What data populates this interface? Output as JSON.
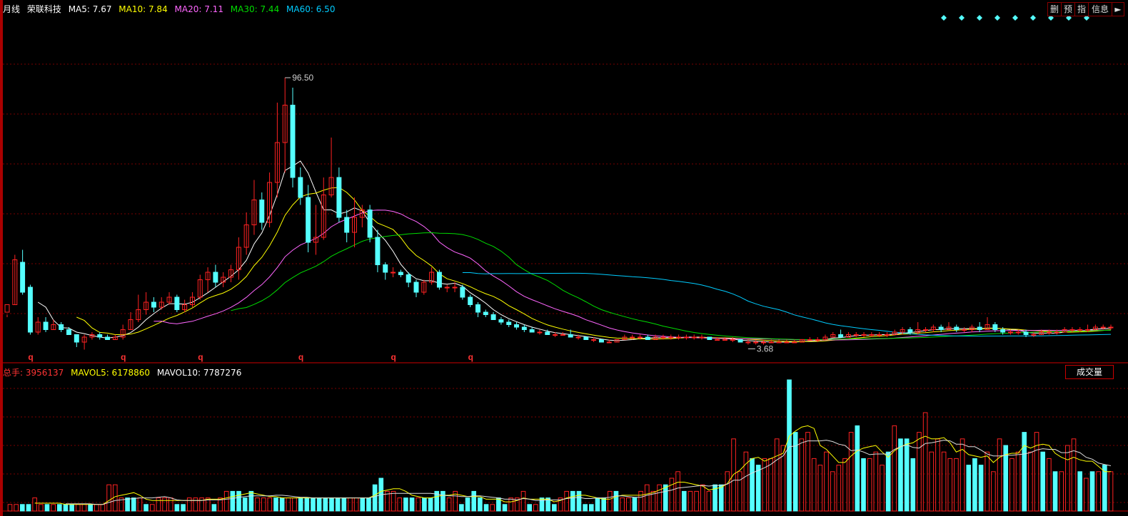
{
  "header": {
    "period": "月线",
    "stock_name": "荣联科技",
    "ma": [
      {
        "label": "MA5: 7.67",
        "color": "#ffffff"
      },
      {
        "label": "MA10: 7.84",
        "color": "#ffff00"
      },
      {
        "label": "MA20: 7.11",
        "color": "#ff66ff"
      },
      {
        "label": "MA30: 7.44",
        "color": "#00dd00"
      },
      {
        "label": "MA60: 6.50",
        "color": "#00ccff"
      }
    ]
  },
  "toolbar": {
    "del": "删",
    "pre": "预",
    "ind": "指",
    "info": "信息",
    "arrow": "►"
  },
  "volume_header": {
    "total": "总手: 3956137",
    "mavol5": "MAVOL5: 6178860",
    "mavol10": "MAVOL10: 7787276",
    "button": "成交量"
  },
  "colors": {
    "up": "#ff2222",
    "down": "#55ffff",
    "grid": "#7a0000",
    "bg": "#000000"
  },
  "chart_data": {
    "type": "candlestick",
    "annotations": {
      "high": "96.50",
      "low": "3.68",
      "q_marker": "q"
    },
    "q_marker_indices": [
      3,
      15,
      25,
      38,
      50,
      60
    ],
    "info_marker_count": 9,
    "candles": [
      [
        12,
        15,
        11,
        10
      ],
      [
        15,
        33,
        35,
        15
      ],
      [
        32,
        20,
        37,
        19
      ],
      [
        22,
        4,
        23,
        3
      ],
      [
        4,
        8,
        10,
        3
      ],
      [
        8,
        5,
        10,
        4
      ],
      [
        5,
        7,
        9,
        5
      ],
      [
        7,
        5,
        8,
        4
      ],
      [
        5,
        3,
        6,
        3
      ],
      [
        3,
        0,
        3,
        -2
      ],
      [
        0,
        2,
        3,
        -3
      ],
      [
        2,
        3,
        4,
        1
      ],
      [
        3,
        2,
        4,
        1
      ],
      [
        2,
        1,
        3,
        1
      ],
      [
        1,
        2,
        3,
        1
      ],
      [
        2,
        5,
        7,
        1
      ],
      [
        5,
        9,
        12,
        5
      ],
      [
        9,
        13,
        19,
        8
      ],
      [
        13,
        16,
        20,
        11
      ],
      [
        16,
        14,
        18,
        12
      ],
      [
        14,
        16,
        18,
        13
      ],
      [
        16,
        18,
        20,
        15
      ],
      [
        18,
        13,
        19,
        12
      ],
      [
        13,
        15,
        17,
        12
      ],
      [
        15,
        18,
        20,
        14
      ],
      [
        18,
        25,
        27,
        17
      ],
      [
        25,
        28,
        30,
        20
      ],
      [
        28,
        24,
        31,
        22
      ],
      [
        24,
        26,
        28,
        22
      ],
      [
        26,
        29,
        31,
        24
      ],
      [
        29,
        38,
        42,
        25
      ],
      [
        38,
        47,
        52,
        35
      ],
      [
        47,
        57,
        65,
        43
      ],
      [
        57,
        48,
        60,
        45
      ],
      [
        48,
        64,
        68,
        46
      ],
      [
        64,
        80,
        96,
        58
      ],
      [
        80,
        95,
        106,
        68
      ],
      [
        95,
        66,
        102,
        62
      ],
      [
        66,
        58,
        70,
        55
      ],
      [
        58,
        40,
        63,
        36
      ],
      [
        40,
        42,
        55,
        35
      ],
      [
        42,
        59,
        66,
        41
      ],
      [
        59,
        66,
        82,
        58
      ],
      [
        66,
        50,
        70,
        48
      ],
      [
        50,
        44,
        53,
        40
      ],
      [
        44,
        50,
        58,
        38
      ],
      [
        50,
        53,
        55,
        46
      ],
      [
        53,
        42,
        55,
        40
      ],
      [
        42,
        31,
        45,
        28
      ],
      [
        31,
        28,
        32,
        25
      ],
      [
        28,
        28,
        30,
        26
      ],
      [
        28,
        27,
        29,
        26
      ],
      [
        27,
        24,
        28,
        22
      ],
      [
        24,
        20,
        25,
        18
      ],
      [
        20,
        24,
        25,
        19
      ],
      [
        24,
        28,
        30,
        23
      ],
      [
        28,
        22,
        29,
        21
      ],
      [
        22,
        22,
        23,
        20
      ],
      [
        22,
        22,
        24,
        20
      ],
      [
        22,
        18,
        23,
        17
      ],
      [
        18,
        15,
        19,
        14
      ],
      [
        15,
        12,
        16,
        10
      ],
      [
        12,
        11,
        13,
        10
      ],
      [
        11,
        9,
        12,
        9
      ],
      [
        9,
        8,
        10,
        7
      ],
      [
        8,
        7,
        9,
        6
      ],
      [
        7,
        6,
        8,
        5
      ],
      [
        6,
        5,
        7,
        4
      ],
      [
        5,
        4,
        6,
        4
      ],
      [
        4,
        4,
        5,
        3
      ],
      [
        4,
        3,
        5,
        3
      ],
      [
        3,
        3,
        4,
        2
      ],
      [
        3,
        3,
        4,
        3
      ],
      [
        3,
        2,
        5,
        2
      ],
      [
        2,
        2,
        3,
        1
      ],
      [
        2,
        1,
        2,
        1
      ],
      [
        1,
        1,
        2,
        0
      ],
      [
        1,
        0,
        1,
        0
      ],
      [
        0,
        0,
        1,
        0
      ],
      [
        0,
        1,
        1,
        0
      ],
      [
        1,
        2,
        3,
        1
      ],
      [
        2,
        2,
        3,
        1
      ],
      [
        2,
        2,
        3,
        1
      ],
      [
        2,
        1,
        3,
        1
      ],
      [
        1,
        2,
        3,
        1
      ],
      [
        2,
        2,
        3,
        1
      ],
      [
        2,
        2,
        3,
        1
      ],
      [
        2,
        2,
        3,
        1
      ],
      [
        2,
        2,
        3,
        1
      ],
      [
        2,
        2,
        3,
        1
      ],
      [
        2,
        2,
        3,
        1
      ],
      [
        2,
        1,
        2,
        1
      ],
      [
        1,
        1,
        2,
        1
      ],
      [
        1,
        1,
        2,
        1
      ],
      [
        1,
        1,
        2,
        0
      ],
      [
        1,
        0,
        1,
        0
      ],
      [
        0,
        0,
        1,
        -1
      ],
      [
        0,
        0,
        1,
        -1
      ],
      [
        0,
        0,
        1,
        -1
      ],
      [
        0,
        0,
        1,
        0
      ],
      [
        0,
        0,
        1,
        0
      ],
      [
        0,
        0,
        1,
        0
      ],
      [
        0,
        0,
        1,
        0
      ],
      [
        0,
        1,
        1,
        0
      ],
      [
        1,
        1,
        2,
        1
      ],
      [
        1,
        1,
        2,
        0
      ],
      [
        1,
        2,
        3,
        1
      ],
      [
        2,
        3,
        4,
        2
      ],
      [
        3,
        2,
        5,
        2
      ],
      [
        2,
        3,
        4,
        2
      ],
      [
        3,
        3,
        4,
        2
      ],
      [
        3,
        3,
        4,
        2
      ],
      [
        3,
        3,
        4,
        2
      ],
      [
        3,
        3,
        4,
        2
      ],
      [
        3,
        3,
        4,
        2
      ],
      [
        3,
        4,
        5,
        3
      ],
      [
        4,
        5,
        6,
        3
      ],
      [
        5,
        4,
        6,
        3
      ],
      [
        4,
        5,
        8,
        3
      ],
      [
        5,
        5,
        6,
        4
      ],
      [
        5,
        6,
        7,
        4
      ],
      [
        6,
        5,
        7,
        4
      ],
      [
        5,
        6,
        8,
        5
      ],
      [
        6,
        5,
        7,
        4
      ],
      [
        5,
        5,
        6,
        4
      ],
      [
        5,
        6,
        7,
        4
      ],
      [
        6,
        5,
        8,
        4
      ],
      [
        5,
        7,
        10,
        5
      ],
      [
        7,
        5,
        8,
        4
      ],
      [
        5,
        4,
        6,
        3
      ],
      [
        4,
        4,
        5,
        3
      ],
      [
        4,
        4,
        5,
        3
      ],
      [
        4,
        3,
        5,
        2
      ],
      [
        3,
        3,
        4,
        2
      ],
      [
        3,
        4,
        5,
        3
      ],
      [
        4,
        4,
        5,
        3
      ],
      [
        4,
        4,
        5,
        3
      ],
      [
        4,
        5,
        6,
        4
      ],
      [
        5,
        5,
        6,
        4
      ],
      [
        5,
        5,
        6,
        4
      ],
      [
        5,
        5,
        7,
        4
      ],
      [
        5,
        6,
        7,
        5
      ],
      [
        6,
        6,
        7,
        5
      ],
      [
        6,
        6,
        7,
        5
      ]
    ],
    "volumes": [
      [
        1,
        1
      ],
      [
        1,
        1
      ],
      [
        1,
        -1
      ],
      [
        1,
        -1
      ],
      [
        2,
        1
      ],
      [
        1,
        1
      ],
      [
        1,
        -1
      ],
      [
        1,
        1
      ],
      [
        1,
        -1
      ],
      [
        1,
        -1
      ],
      [
        1,
        -1
      ],
      [
        1,
        1
      ],
      [
        1,
        1
      ],
      [
        1,
        -1
      ],
      [
        1,
        1
      ],
      [
        1,
        1
      ],
      [
        4,
        1
      ],
      [
        4,
        1
      ],
      [
        2,
        1
      ],
      [
        2,
        -1
      ],
      [
        2,
        -1
      ],
      [
        2,
        1
      ],
      [
        1,
        -1
      ],
      [
        1,
        1
      ],
      [
        2,
        1
      ],
      [
        2,
        1
      ],
      [
        2,
        1
      ],
      [
        1,
        -1
      ],
      [
        1,
        -1
      ],
      [
        2,
        1
      ],
      [
        2,
        1
      ],
      [
        2,
        1
      ],
      [
        2,
        1
      ],
      [
        1,
        -1
      ],
      [
        2,
        1
      ],
      [
        3,
        1
      ],
      [
        3,
        -1
      ],
      [
        3,
        -1
      ],
      [
        2,
        -1
      ],
      [
        3,
        -1
      ],
      [
        2,
        1
      ],
      [
        2,
        1
      ],
      [
        2,
        1
      ],
      [
        2,
        -1
      ],
      [
        2,
        -1
      ],
      [
        2,
        1
      ],
      [
        2,
        1
      ],
      [
        2,
        -1
      ],
      [
        2,
        -1
      ],
      [
        2,
        -1
      ],
      [
        2,
        -1
      ],
      [
        2,
        -1
      ],
      [
        2,
        -1
      ],
      [
        2,
        -1
      ],
      [
        2,
        -1
      ],
      [
        2,
        1
      ],
      [
        2,
        1
      ],
      [
        2,
        -1
      ],
      [
        2,
        -1
      ],
      [
        4,
        -1
      ],
      [
        5,
        -1
      ],
      [
        3,
        1
      ],
      [
        3,
        1
      ],
      [
        2,
        1
      ],
      [
        2,
        -1
      ],
      [
        2,
        -1
      ],
      [
        2,
        1
      ],
      [
        2,
        -1
      ],
      [
        2,
        -1
      ],
      [
        3,
        -1
      ],
      [
        3,
        -1
      ],
      [
        2,
        1
      ],
      [
        3,
        1
      ],
      [
        1,
        -1
      ],
      [
        2,
        -1
      ],
      [
        3,
        -1
      ],
      [
        2,
        -1
      ],
      [
        1,
        -1
      ],
      [
        1,
        1
      ],
      [
        2,
        -1
      ],
      [
        1,
        -1
      ],
      [
        2,
        1
      ],
      [
        2,
        1
      ],
      [
        3,
        1
      ],
      [
        1,
        -1
      ],
      [
        1,
        1
      ],
      [
        2,
        -1
      ],
      [
        2,
        -1
      ],
      [
        1,
        -1
      ],
      [
        2,
        1
      ],
      [
        3,
        1
      ],
      [
        3,
        -1
      ],
      [
        3,
        -1
      ],
      [
        1,
        -1
      ],
      [
        1,
        -1
      ],
      [
        2,
        -1
      ],
      [
        2,
        -1
      ],
      [
        3,
        1
      ],
      [
        3,
        -1
      ],
      [
        2,
        1
      ],
      [
        2,
        1
      ],
      [
        2,
        -1
      ],
      [
        3,
        1
      ],
      [
        4,
        1
      ],
      [
        3,
        1
      ],
      [
        4,
        1
      ],
      [
        4,
        -1
      ],
      [
        5,
        1
      ],
      [
        6,
        1
      ],
      [
        3,
        -1
      ],
      [
        3,
        1
      ],
      [
        3,
        1
      ],
      [
        4,
        1
      ],
      [
        3,
        1
      ],
      [
        4,
        -1
      ],
      [
        4,
        -1
      ],
      [
        6,
        1
      ],
      [
        11,
        1
      ],
      [
        6,
        1
      ],
      [
        9,
        1
      ],
      [
        8,
        -1
      ],
      [
        7,
        -1
      ],
      [
        8,
        1
      ],
      [
        8,
        1
      ],
      [
        11,
        1
      ],
      [
        10,
        1
      ],
      [
        20,
        -1
      ],
      [
        12,
        -1
      ],
      [
        11,
        1
      ],
      [
        12,
        1
      ],
      [
        8,
        1
      ],
      [
        7,
        1
      ],
      [
        9,
        1
      ],
      [
        6,
        1
      ],
      [
        7,
        1
      ],
      [
        8,
        1
      ],
      [
        12,
        1
      ],
      [
        13,
        -1
      ],
      [
        8,
        -1
      ],
      [
        8,
        1
      ],
      [
        9,
        1
      ],
      [
        7,
        1
      ],
      [
        9,
        -1
      ],
      [
        13,
        1
      ],
      [
        11,
        -1
      ],
      [
        11,
        -1
      ],
      [
        8,
        -1
      ],
      [
        12,
        1
      ],
      [
        15,
        1
      ],
      [
        9,
        1
      ],
      [
        11,
        1
      ],
      [
        9,
        1
      ],
      [
        8,
        1
      ],
      [
        8,
        1
      ],
      [
        11,
        1
      ],
      [
        7,
        -1
      ],
      [
        8,
        -1
      ],
      [
        7,
        -1
      ],
      [
        9,
        1
      ],
      [
        6,
        1
      ],
      [
        11,
        1
      ],
      [
        10,
        -1
      ],
      [
        8,
        1
      ],
      [
        9,
        1
      ],
      [
        12,
        -1
      ],
      [
        9,
        1
      ],
      [
        12,
        1
      ],
      [
        9,
        -1
      ],
      [
        8,
        1
      ],
      [
        6,
        -1
      ],
      [
        6,
        1
      ],
      [
        10,
        1
      ],
      [
        11,
        1
      ],
      [
        6,
        -1
      ],
      [
        5,
        1
      ],
      [
        6,
        -1
      ],
      [
        6,
        1
      ],
      [
        7,
        -1
      ],
      [
        6,
        1
      ]
    ]
  }
}
